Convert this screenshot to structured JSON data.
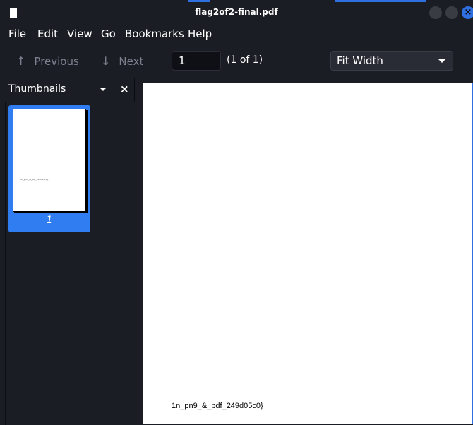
{
  "window": {
    "title": "flag2of2-final.pdf",
    "close_glyph": "×",
    "icon": "document-icon"
  },
  "menu": {
    "items": [
      "File",
      "Edit",
      "View",
      "Go",
      "Bookmarks",
      "Help"
    ]
  },
  "toolbar": {
    "previous_label": "Previous",
    "previous_icon": "↑",
    "next_label": "Next",
    "next_icon": "↓",
    "page_value": "1",
    "page_count": "(1 of 1)",
    "zoom_value": "Fit Width"
  },
  "sidebar": {
    "title": "Thumbnails",
    "close_glyph": "×",
    "thumbnails": [
      {
        "label": "1",
        "preview_text": "1n_pn9_&_pdf_249d05c0}"
      }
    ]
  },
  "document": {
    "page_text": "1n_pn9_&_pdf_249d05c0}"
  },
  "colors": {
    "accent": "#2f7df0",
    "background": "#1b1d24",
    "disabled_text": "#7d8190"
  }
}
